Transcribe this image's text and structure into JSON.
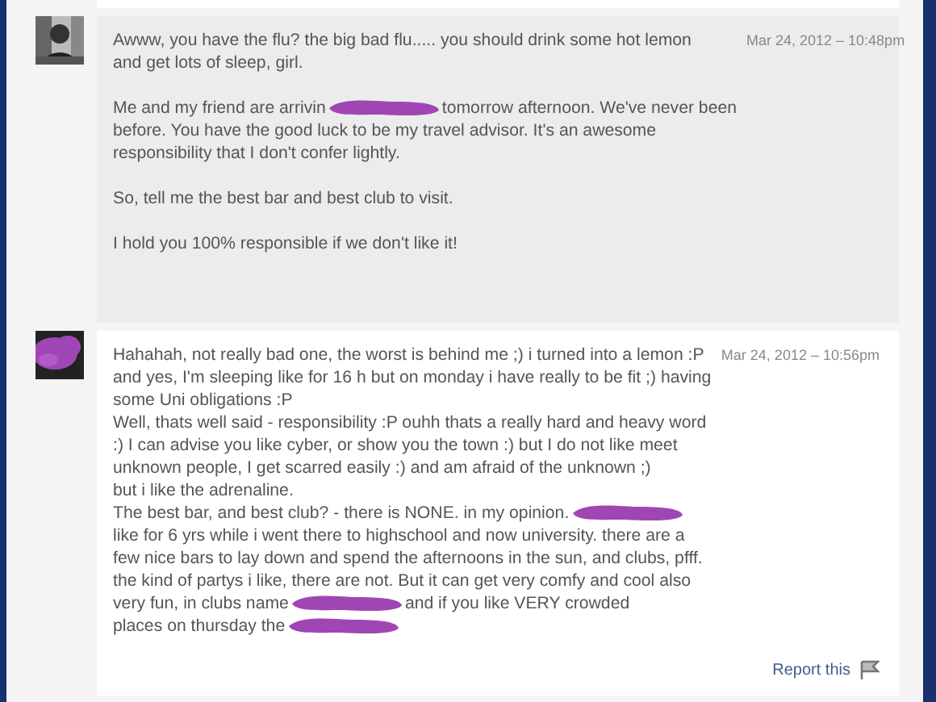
{
  "messages": [
    {
      "avatar": {
        "kind": "picture"
      },
      "date": "Mar 24, 2012 – 10:48pm",
      "color": "#ececec",
      "paragraphs": [
        [
          [
            {
              "kind": "text",
              "text": "Awww, you have the flu? the big bad flu..... you should drink some hot lemon"
            }
          ],
          [
            {
              "kind": "text",
              "text": "and get lots of sleep, girl."
            }
          ]
        ],
        [
          [
            {
              "kind": "text",
              "text": "Me and my friend are arrivin"
            },
            {
              "kind": "redaction"
            },
            {
              "kind": "text",
              "text": "tomorrow afternoon. We've never been"
            }
          ],
          [
            {
              "kind": "text",
              "text": "before. You have the good luck to be my travel advisor. It's an awesome"
            }
          ],
          [
            {
              "kind": "text",
              "text": "responsibility that I don't confer lightly."
            }
          ]
        ],
        [
          [
            {
              "kind": "text",
              "text": "So, tell me the best bar and best club to visit."
            }
          ]
        ],
        [
          [
            {
              "kind": "text",
              "text": "I hold you 100% responsible if we don't like it!"
            }
          ]
        ]
      ]
    },
    {
      "avatar": {
        "kind": "picture"
      },
      "date": "Mar 24, 2012 – 10:56pm",
      "color": "#ffffff",
      "report": "Report this",
      "paragraphs": [
        [
          [
            {
              "kind": "text",
              "text": "Hahahah, not really bad one, the worst is behind me ;) i turned into a lemon :P"
            }
          ],
          [
            {
              "kind": "text",
              "text": "and yes, I'm sleeping like for 16 h but on monday i have really to be fit ;) having"
            }
          ],
          [
            {
              "kind": "text",
              "text": "some Uni obligations :P"
            }
          ],
          [
            {
              "kind": "text",
              "text": "Well, thats well said - responsibility :P ouhh thats a really hard and heavy word"
            }
          ],
          [
            {
              "kind": "text",
              "text": ":) I can advise you like cyber, or show you the town :) but I do not like meet"
            }
          ],
          [
            {
              "kind": "text",
              "text": "unknown people, I get scarred easily :) and am afraid of the unknown ;)"
            }
          ],
          [
            {
              "kind": "text",
              "text": "but i like the adrenaline."
            }
          ],
          [
            {
              "kind": "text",
              "text": "The best bar, and best club? - there is NONE. in my opinion."
            },
            {
              "kind": "redaction"
            }
          ],
          [
            {
              "kind": "text",
              "text": "like for 6 yrs while i went there to highschool and now university. there are a"
            }
          ],
          [
            {
              "kind": "text",
              "text": "few nice bars to lay down and spend the afternoons in the sun, and clubs, pfff."
            }
          ],
          [
            {
              "kind": "text",
              "text": "the kind of partys i like, there are not. But it can get very comfy and cool also"
            }
          ],
          [
            {
              "kind": "text",
              "text": "very fun, in clubs name"
            },
            {
              "kind": "redaction"
            },
            {
              "kind": "text",
              "text": "and if you like VERY crowded"
            }
          ],
          [
            {
              "kind": "text",
              "text": "places on thursday the"
            },
            {
              "kind": "redaction"
            }
          ]
        ]
      ]
    }
  ]
}
